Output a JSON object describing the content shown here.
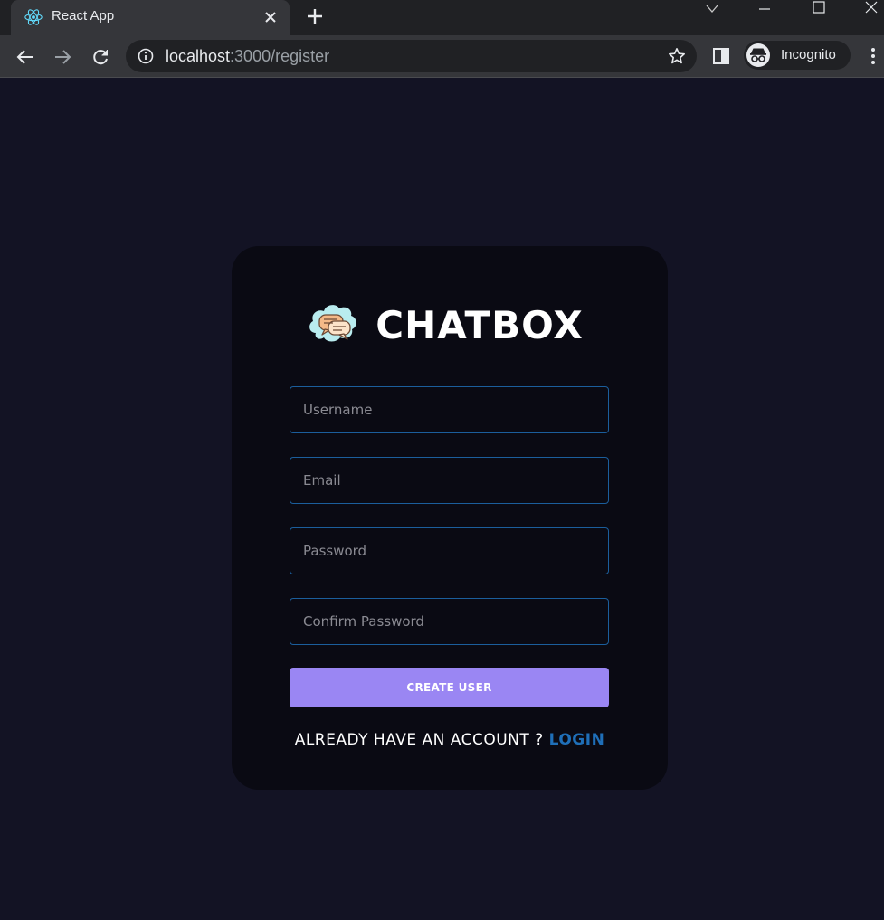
{
  "browser": {
    "tab_title": "React App",
    "url_host": "localhost",
    "url_path": ":3000/register",
    "profile_label": "Incognito"
  },
  "icons": {
    "favicon": "react-logo-icon",
    "tab_close": "close-icon",
    "new_tab": "plus-icon",
    "back": "arrow-left-icon",
    "forward": "arrow-right-icon",
    "reload": "reload-icon",
    "site_info": "info-icon",
    "bookmark": "star-icon",
    "side_panel": "side-panel-icon",
    "incognito": "incognito-icon",
    "menu": "kebab-menu-icon",
    "brand": "chat-bubbles-logo-icon"
  },
  "colors": {
    "page_bg": "#131324",
    "card_bg": "#0a0a13",
    "input_border": "#1b5e9c",
    "button_bg": "#9a86f3",
    "link": "#1f6fb8"
  },
  "form": {
    "brand_name": "CHATBOX",
    "username_placeholder": "Username",
    "email_placeholder": "Email",
    "password_placeholder": "Password",
    "confirm_password_placeholder": "Confirm Password",
    "submit_label": "CREATE USER",
    "login_prompt": "ALREADY HAVE AN ACCOUNT ?",
    "login_link": "LOGIN"
  }
}
